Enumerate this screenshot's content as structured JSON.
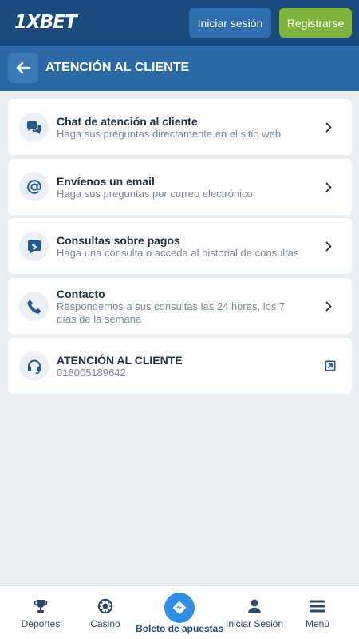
{
  "header": {
    "logo_text": "1XBET",
    "login_label": "Iniciar sesión",
    "register_label": "Registrarse"
  },
  "subheader": {
    "title": "ATENCIÓN AL CLIENTE"
  },
  "cards": [
    {
      "title": "Chat de atención al cliente",
      "desc": "Haga sus preguntas directamente en el sitio web",
      "icon": "chat-icon",
      "action": "chevron-right-icon"
    },
    {
      "title": "Envíenos un email",
      "desc": "Haga sus preguntas por correo electrónico",
      "icon": "at-sign-icon",
      "action": "chevron-right-icon"
    },
    {
      "title": "Consultas sobre pagos",
      "desc": "Haga una consulta o acceda al historial de consultas",
      "icon": "payment-chat-icon",
      "action": "chevron-right-icon"
    },
    {
      "title": "Contacto",
      "desc": "Respondemos a sus consultas las 24 horas, los 7 días de la semana",
      "icon": "phone-icon",
      "action": "chevron-right-icon"
    },
    {
      "title": "ATENCIÓN AL CLIENTE",
      "desc": "018005189642",
      "icon": "headset-icon",
      "action": "external-link-icon"
    }
  ],
  "bottom_nav": [
    {
      "label": "Deportes",
      "icon": "trophy-icon"
    },
    {
      "label": "Casino",
      "icon": "casino-chip-icon"
    },
    {
      "label": "Boleto de apuestas",
      "icon": "ticket-icon"
    },
    {
      "label": "Iniciar Sesión",
      "icon": "user-icon"
    },
    {
      "label": "Menú",
      "icon": "hamburger-icon"
    }
  ],
  "colors": {
    "topbar": "#1b4b7c",
    "subheader": "#2b69a6",
    "register": "#7fb33d",
    "login": "#2e6fb0",
    "accent": "#2d8fe6",
    "icon": "#1f5a96"
  }
}
